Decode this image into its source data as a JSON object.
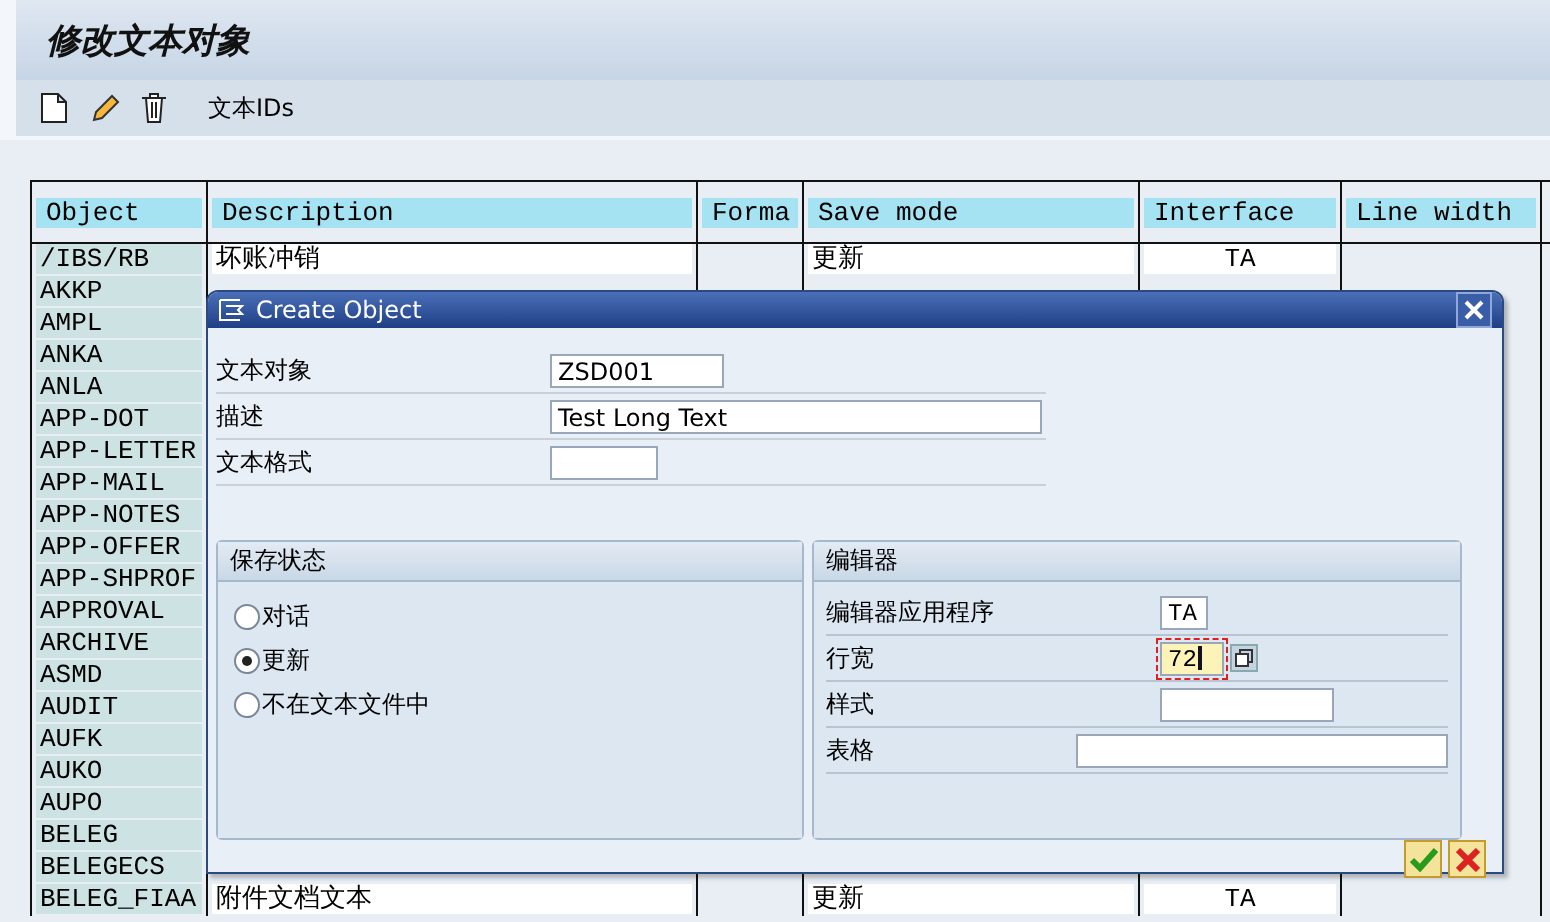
{
  "window": {
    "title": "修改文本对象"
  },
  "toolbar": {
    "text_ids_label": "文本IDs"
  },
  "table": {
    "columns": [
      "Object",
      "Description",
      "Forma",
      "Save mode",
      "Interface",
      "Line width"
    ],
    "rows": [
      {
        "object": "/IBS/RB",
        "description": "坏账冲销",
        "save_mode": "更新",
        "interface": "TA"
      },
      {
        "object": "AKKP"
      },
      {
        "object": "AMPL"
      },
      {
        "object": "ANKA"
      },
      {
        "object": "ANLA"
      },
      {
        "object": "APP-DOT"
      },
      {
        "object": "APP-LETTER"
      },
      {
        "object": "APP-MAIL"
      },
      {
        "object": "APP-NOTES"
      },
      {
        "object": "APP-OFFER"
      },
      {
        "object": "APP-SHPROF"
      },
      {
        "object": "APPROVAL"
      },
      {
        "object": "ARCHIVE"
      },
      {
        "object": "ASMD"
      },
      {
        "object": "AUDIT"
      },
      {
        "object": "AUFK"
      },
      {
        "object": "AUKO"
      },
      {
        "object": "AUPO"
      },
      {
        "object": "BELEG"
      },
      {
        "object": "BELEGECS"
      },
      {
        "object": "BELEG_FIAA",
        "description": "附件文档文本",
        "save_mode": "更新",
        "interface": "TA"
      }
    ]
  },
  "dialog": {
    "title": "Create Object",
    "fields": [
      {
        "label": "文本对象",
        "value": "ZSD001"
      },
      {
        "label": "描述",
        "value": "Test Long Text"
      },
      {
        "label": "文本格式"
      }
    ],
    "save_status": {
      "title": "保存状态",
      "options": [
        {
          "label": "对话",
          "selected": false
        },
        {
          "label": "更新",
          "selected": true
        },
        {
          "label": "不在文本文件中",
          "selected": false
        }
      ]
    },
    "editor": {
      "title": "编辑器",
      "fields": [
        {
          "label": "编辑器应用程序",
          "value": "TA",
          "focused": false
        },
        {
          "label": "行宽",
          "value": "72",
          "focused": true
        },
        {
          "label": "样式",
          "focused": false
        },
        {
          "label": "表格",
          "focused": false
        }
      ]
    }
  }
}
